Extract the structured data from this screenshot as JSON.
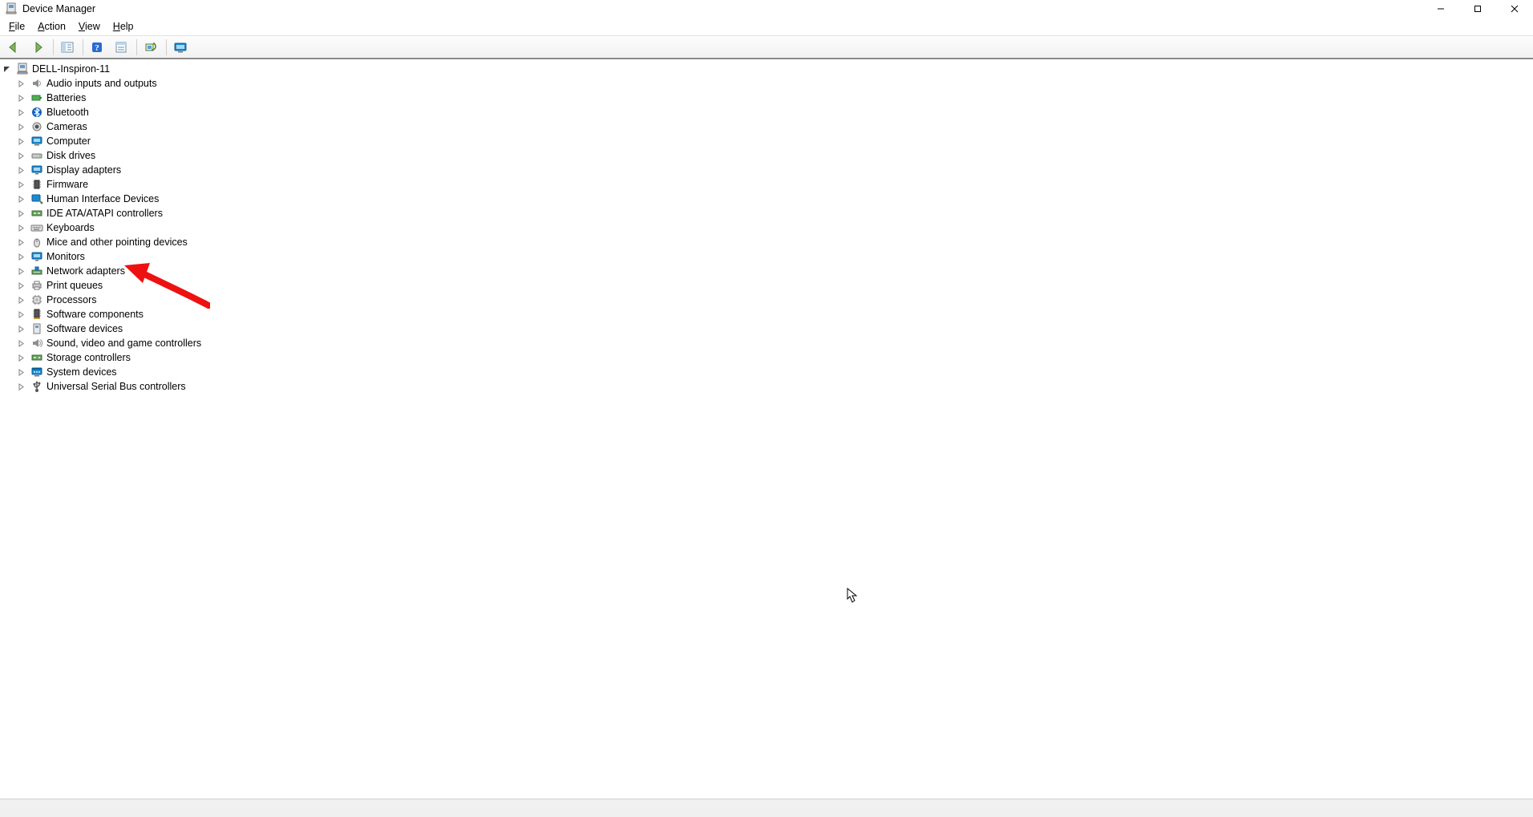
{
  "window": {
    "title": "Device Manager"
  },
  "menubar": {
    "items": [
      {
        "label": "File",
        "hotkey_index": 0
      },
      {
        "label": "Action",
        "hotkey_index": 0
      },
      {
        "label": "View",
        "hotkey_index": 0
      },
      {
        "label": "Help",
        "hotkey_index": 0
      }
    ]
  },
  "toolbar": {
    "buttons": [
      {
        "name": "nav-back",
        "icon": "arrow-left"
      },
      {
        "name": "nav-forward",
        "icon": "arrow-right"
      },
      {
        "name": "sep"
      },
      {
        "name": "show-hide-tree",
        "icon": "tree-pane"
      },
      {
        "name": "sep"
      },
      {
        "name": "help",
        "icon": "help"
      },
      {
        "name": "properties",
        "icon": "properties"
      },
      {
        "name": "sep"
      },
      {
        "name": "scan-hardware",
        "icon": "scan"
      },
      {
        "name": "sep"
      },
      {
        "name": "hidden-devices",
        "icon": "monitor-hidden"
      }
    ]
  },
  "tree": {
    "root": {
      "label": "DELL-Inspiron-11",
      "icon": "computer-root",
      "expanded": true,
      "children": [
        {
          "label": "Audio inputs and outputs",
          "icon": "audio"
        },
        {
          "label": "Batteries",
          "icon": "battery"
        },
        {
          "label": "Bluetooth",
          "icon": "bluetooth"
        },
        {
          "label": "Cameras",
          "icon": "camera"
        },
        {
          "label": "Computer",
          "icon": "computer"
        },
        {
          "label": "Disk drives",
          "icon": "disk"
        },
        {
          "label": "Display adapters",
          "icon": "display-adapter"
        },
        {
          "label": "Firmware",
          "icon": "firmware"
        },
        {
          "label": "Human Interface Devices",
          "icon": "hid"
        },
        {
          "label": "IDE ATA/ATAPI controllers",
          "icon": "ide"
        },
        {
          "label": "Keyboards",
          "icon": "keyboard"
        },
        {
          "label": "Mice and other pointing devices",
          "icon": "mouse"
        },
        {
          "label": "Monitors",
          "icon": "monitor"
        },
        {
          "label": "Network adapters",
          "icon": "network"
        },
        {
          "label": "Print queues",
          "icon": "printer"
        },
        {
          "label": "Processors",
          "icon": "processor"
        },
        {
          "label": "Software components",
          "icon": "sw-component"
        },
        {
          "label": "Software devices",
          "icon": "sw-device"
        },
        {
          "label": "Sound, video and game controllers",
          "icon": "sound"
        },
        {
          "label": "Storage controllers",
          "icon": "storage"
        },
        {
          "label": "System devices",
          "icon": "system"
        },
        {
          "label": "Universal Serial Bus controllers",
          "icon": "usb"
        }
      ]
    }
  },
  "annotation": {
    "arrow_points_to": "Network adapters"
  }
}
